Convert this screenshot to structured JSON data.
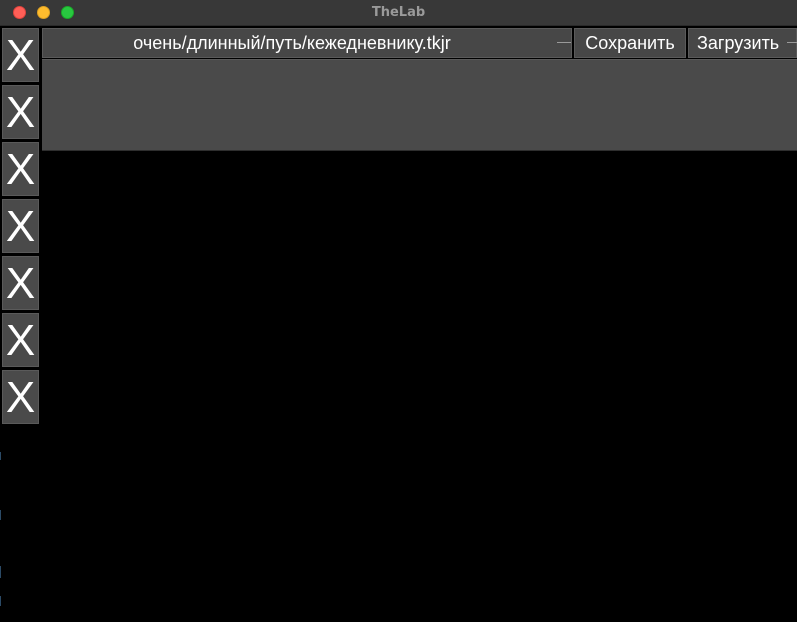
{
  "window": {
    "title": "TheLab"
  },
  "sidebar": {
    "buttons": [
      {
        "label": "X"
      },
      {
        "label": "X"
      },
      {
        "label": "X"
      },
      {
        "label": "X"
      },
      {
        "label": "X"
      },
      {
        "label": "X"
      },
      {
        "label": "X"
      }
    ]
  },
  "toolbar": {
    "path_value": "очень/длинный/путь/кежедневнику.tkjr",
    "save_label": "Сохранить",
    "load_label": "Загрузить"
  },
  "colors": {
    "background": "#000000",
    "titlebar": "#383838",
    "control": "#4a4a4a",
    "text": "#ffffff",
    "close": "#ff5f57",
    "minimize": "#febc2e",
    "maximize": "#28c840"
  },
  "icons": {
    "close": "close-window-icon",
    "minimize": "minimize-window-icon",
    "maximize": "maximize-window-icon"
  }
}
